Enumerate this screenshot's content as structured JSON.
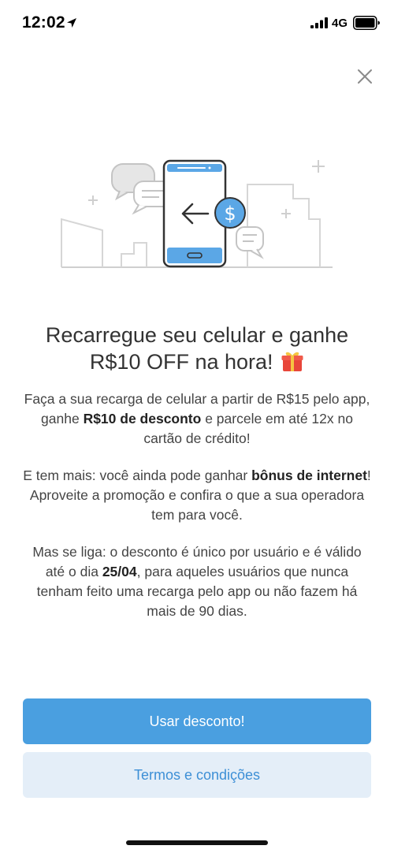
{
  "status_bar": {
    "time": "12:02",
    "network": "4G"
  },
  "headline": {
    "line1": "Recarregue seu celular e ganhe",
    "line2": "R$10 OFF na hora!"
  },
  "paragraph1": {
    "before": "Faça a sua recarga de celular a partir de R$15 pelo app, ganhe ",
    "bold": "R$10 de desconto",
    "after": " e parcele em até 12x no cartão de crédito!"
  },
  "paragraph2": {
    "before": "E tem mais: você ainda pode ganhar ",
    "bold": "bônus de internet",
    "after": "! Aproveite a promoção e confira o que a sua operadora tem para você."
  },
  "paragraph3": {
    "before": "Mas se liga: o desconto é único por usuário e é válido até o dia ",
    "bold": "25/04",
    "after": ", para aqueles usuários que nunca tenham feito uma recarga pelo app ou não fazem há mais de 90 dias."
  },
  "buttons": {
    "primary_label": "Usar desconto!",
    "secondary_label": "Termos e condições"
  },
  "icons": {
    "close": "close-icon",
    "gift": "gift-icon",
    "illustration": "phone-recharge-illustration"
  },
  "colors": {
    "primary_button": "#4a9fe0",
    "secondary_button_bg": "#e4eef8",
    "secondary_button_text": "#3d8fd6"
  }
}
